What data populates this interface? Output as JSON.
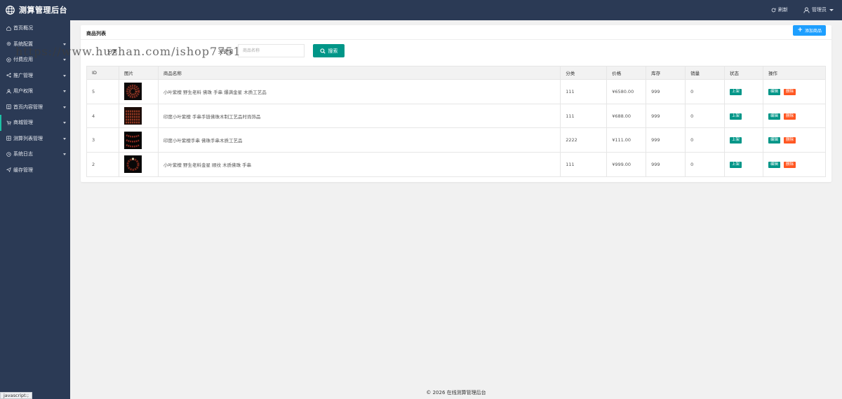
{
  "app": {
    "title": "测算管理后台"
  },
  "header": {
    "refresh_label": "刷新",
    "user_label": "管理员"
  },
  "sidebar": {
    "items": [
      {
        "label": "首页概况",
        "icon": "home-icon",
        "has_submenu": false
      },
      {
        "label": "系统配置",
        "icon": "gear-icon",
        "has_submenu": true
      },
      {
        "label": "付费应用",
        "icon": "target-icon",
        "has_submenu": true
      },
      {
        "label": "推广管理",
        "icon": "share-icon",
        "has_submenu": true
      },
      {
        "label": "用户权限",
        "icon": "user-icon",
        "has_submenu": true
      },
      {
        "label": "首页内容管理",
        "icon": "list-icon",
        "has_submenu": true
      },
      {
        "label": "商城管理",
        "icon": "cart-icon",
        "has_submenu": true,
        "active": true
      },
      {
        "label": "测算列表管理",
        "icon": "grid-icon",
        "has_submenu": true
      },
      {
        "label": "系统日志",
        "icon": "clock-icon",
        "has_submenu": true
      },
      {
        "label": "缓存管理",
        "icon": "send-icon",
        "has_submenu": false
      }
    ]
  },
  "panel": {
    "title": "商品列表",
    "add_button": "添加商品",
    "filter": {
      "category_label": "分类",
      "keyword_label": "关键词",
      "keyword_placeholder": "商品名称",
      "search_button": "搜索"
    }
  },
  "watermark": "https://www.huzhan.com/ishop7751",
  "table": {
    "columns": [
      "ID",
      "图片",
      "商品名称",
      "分类",
      "价格",
      "库存",
      "销量",
      "状态",
      "操作"
    ],
    "rows": [
      {
        "id": "5",
        "name": "小叶紫檀 野生老料 佛珠 手串 爆满金星 木质工艺品",
        "category": "111",
        "price": "¥6580.00",
        "stock": "999",
        "sales": "0",
        "status": "上架"
      },
      {
        "id": "4",
        "name": "印度小叶紫檀 手串手链佛珠木制工艺品时尚饰品",
        "category": "111",
        "price": "¥688.00",
        "stock": "999",
        "sales": "0",
        "status": "上架"
      },
      {
        "id": "3",
        "name": "印度小叶紫檀手串 佛珠手串木质工艺品",
        "category": "2222",
        "price": "¥111.00",
        "stock": "999",
        "sales": "0",
        "status": "上架"
      },
      {
        "id": "2",
        "name": "小叶紫檀 野生老料金星 顺纹 木质佛珠 手串",
        "category": "111",
        "price": "¥999.00",
        "stock": "999",
        "sales": "0",
        "status": "上架"
      }
    ],
    "edit_label": "编辑",
    "delete_label": "删除"
  },
  "footer": {
    "text": "© 2026 在线测算管理后台"
  },
  "statusbar": {
    "text": "javascript:;"
  },
  "colors": {
    "sidebar": "#2b3a55",
    "primary": "#009688",
    "add": "#1e9fff",
    "danger": "#ff5722"
  }
}
